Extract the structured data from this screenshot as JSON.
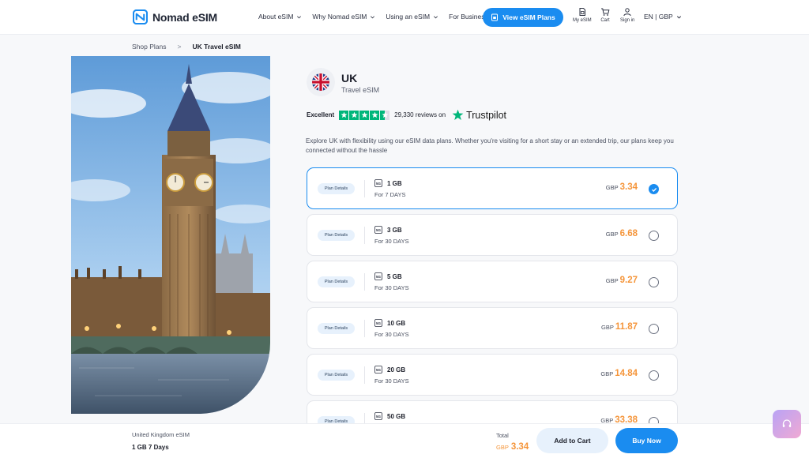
{
  "header": {
    "brand": "Nomad eSIM",
    "nav": [
      {
        "label": "About eSIM",
        "has_dropdown": true
      },
      {
        "label": "Why Nomad eSIM",
        "has_dropdown": true
      },
      {
        "label": "Using an eSIM",
        "has_dropdown": true
      },
      {
        "label": "For Business",
        "has_dropdown": false
      }
    ],
    "cta_label": "View eSIM Plans",
    "my_esim_label": "My eSIM",
    "cart_label": "Cart",
    "signin_label": "Sign in",
    "language": "EN | GBP"
  },
  "breadcrumb": {
    "root": "Shop Plans",
    "separator": ">",
    "current": "UK Travel eSIM"
  },
  "product": {
    "title": "UK",
    "subtitle": "Travel eSIM",
    "rating_label": "Excellent",
    "rating_stars": 4.5,
    "reviews_text": "29,330 reviews on",
    "trustpilot_label": "Trustpilot",
    "description": "Explore UK with flexibility using our eSIM data plans. Whether you're visiting for a short stay or an extended trip, our plans keep you connected without the hassle"
  },
  "plans": [
    {
      "details_label": "Plan Details",
      "network": "5G",
      "data": "1 GB",
      "duration": "For 7 DAYS",
      "currency": "GBP",
      "price": "3.34",
      "selected": true
    },
    {
      "details_label": "Plan Details",
      "network": "5G",
      "data": "3 GB",
      "duration": "For 30 DAYS",
      "currency": "GBP",
      "price": "6.68",
      "selected": false
    },
    {
      "details_label": "Plan Details",
      "network": "5G",
      "data": "5 GB",
      "duration": "For 30 DAYS",
      "currency": "GBP",
      "price": "9.27",
      "selected": false
    },
    {
      "details_label": "Plan Details",
      "network": "5G",
      "data": "10 GB",
      "duration": "For 30 DAYS",
      "currency": "GBP",
      "price": "11.87",
      "selected": false
    },
    {
      "details_label": "Plan Details",
      "network": "5G",
      "data": "20 GB",
      "duration": "For 30 DAYS",
      "currency": "GBP",
      "price": "14.84",
      "selected": false
    },
    {
      "details_label": "Plan Details",
      "network": "5G",
      "data": "50 GB",
      "duration": "",
      "currency": "GBP",
      "price": "33.38",
      "selected": false
    }
  ],
  "bottom_bar": {
    "product_name": "United Kingdom eSIM",
    "selected_plan": "1 GB 7 Days",
    "total_label": "Total",
    "total_currency": "GBP",
    "total_price": "3.34",
    "add_to_cart_label": "Add to Cart",
    "buy_now_label": "Buy Now"
  },
  "colors": {
    "accent": "#1a8cf0",
    "price": "#f5953a",
    "trustpilot_green": "#00b67a"
  },
  "icons": {
    "logo": "nomad-logo-icon",
    "cta": "sim-card-icon",
    "my_esim": "sim-icon",
    "cart": "cart-icon",
    "signin": "user-icon",
    "selected": "check-icon",
    "support": "headset-icon"
  }
}
